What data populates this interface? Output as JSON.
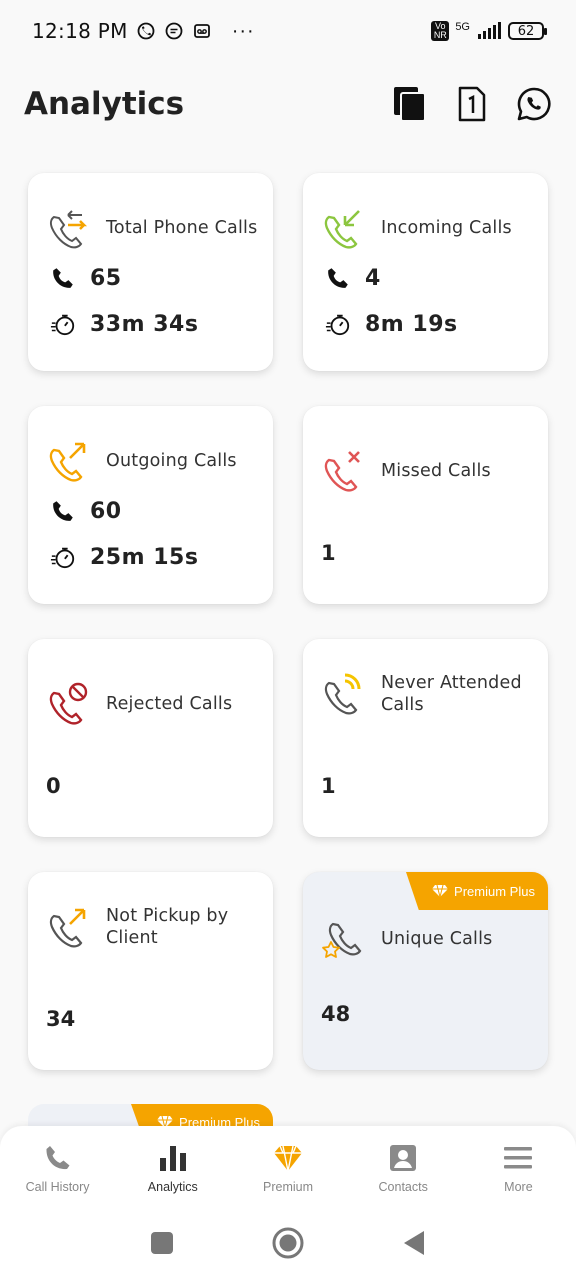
{
  "status_bar": {
    "time": "12:18 PM",
    "more": "···",
    "network_5g": "5G",
    "volte": "Vo NR",
    "battery": "62"
  },
  "header": {
    "title": "Analytics",
    "icons": [
      "documents-icon",
      "sim-1-icon",
      "whatsapp-icon"
    ]
  },
  "cards": [
    {
      "title": "Total Phone Calls",
      "count": "65",
      "duration": "33m 34s",
      "icon": "total-calls-icon",
      "color": "#f5a400"
    },
    {
      "title": "Incoming Calls",
      "count": "4",
      "duration": "8m 19s",
      "icon": "incoming-call-icon",
      "color": "#8cc63f"
    },
    {
      "title": "Outgoing Calls",
      "count": "60",
      "duration": "25m 15s",
      "icon": "outgoing-call-icon",
      "color": "#f5a400"
    },
    {
      "title": "Missed Calls",
      "value": "1",
      "icon": "missed-call-icon",
      "color": "#e05555"
    },
    {
      "title": "Rejected Calls",
      "value": "0",
      "icon": "rejected-call-icon",
      "color": "#b0232a"
    },
    {
      "title": "Never Attended Calls",
      "value": "1",
      "icon": "never-attended-icon",
      "color": "#f5c400"
    },
    {
      "title": "Not Pickup by Client",
      "value": "34",
      "icon": "not-pickup-icon",
      "color": "#f5a400"
    },
    {
      "title": "Unique Calls",
      "value": "48",
      "icon": "unique-calls-icon",
      "badge": "Premium Plus",
      "color": "#f5a400"
    }
  ],
  "peek_badge": "Premium Plus",
  "bottom_nav": [
    {
      "label": "Call History",
      "icon": "phone-icon",
      "active": false
    },
    {
      "label": "Analytics",
      "icon": "bar-chart-icon",
      "active": true
    },
    {
      "label": "Premium",
      "icon": "diamond-icon",
      "active": false
    },
    {
      "label": "Contacts",
      "icon": "contact-icon",
      "active": false
    },
    {
      "label": "More",
      "icon": "menu-icon",
      "active": false
    }
  ],
  "colors": {
    "accent": "#f5a400",
    "text": "#222222",
    "muted": "#888888"
  }
}
